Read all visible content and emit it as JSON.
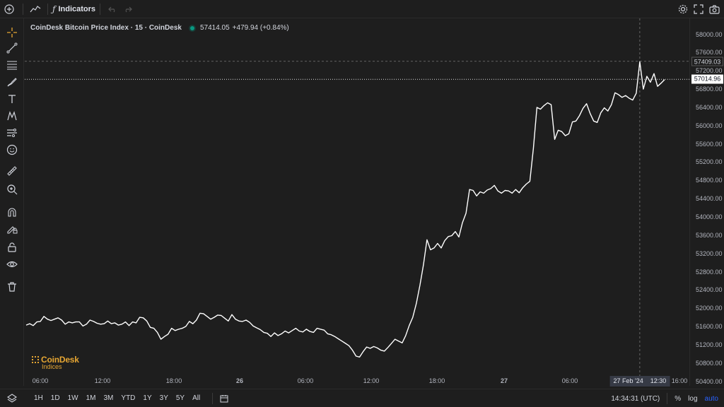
{
  "toolbar": {
    "indicators_label": "Indicators",
    "icons": [
      "add-icon",
      "line-chart-icon",
      "fx-icon",
      "undo-icon",
      "redo-icon",
      "settings-icon",
      "fullscreen-icon",
      "camera-icon"
    ]
  },
  "left_tools": [
    "crosshair-icon",
    "trend-line-icon",
    "fib-levels-icon",
    "brush-icon",
    "text-icon",
    "pattern-icon",
    "forecast-icon",
    "emoji-icon",
    "ruler-icon",
    "zoom-in-icon",
    "magnet-icon",
    "lock-drawing-icon",
    "lock-icon",
    "eye-icon",
    "trash-icon"
  ],
  "legend": {
    "symbol": "CoinDesk Bitcoin Price Index · 15 · CoinDesk",
    "price": "57414.05",
    "change": "+479.94 (+0.84%)"
  },
  "logo": {
    "name": "CoinDesk",
    "sub": "Indices"
  },
  "price_axis": {
    "ticks": [
      "58000.00",
      "57600.00",
      "57200.00",
      "56800.00",
      "56400.00",
      "56000.00",
      "55600.00",
      "55200.00",
      "54800.00",
      "54400.00",
      "54000.00",
      "53600.00",
      "53200.00",
      "52800.00",
      "52400.00",
      "52000.00",
      "51600.00",
      "51200.00",
      "50800.00",
      "50400.00"
    ],
    "crosshair_label": "57409.03",
    "last_price_label": "57014.96"
  },
  "time_axis": {
    "ticks": [
      "06:00",
      "12:00",
      "18:00",
      "26",
      "06:00",
      "12:00",
      "18:00",
      "27",
      "06:00",
      "16:00"
    ],
    "crosshair_date": "27 Feb '24",
    "crosshair_time": "12:30"
  },
  "bottom": {
    "ranges": [
      "1H",
      "1D",
      "1W",
      "1M",
      "3M",
      "YTD",
      "1Y",
      "3Y",
      "5Y",
      "All"
    ],
    "clock": "14:34:31 (UTC)",
    "percent": "%",
    "log": "log",
    "auto": "auto"
  },
  "chart_data": {
    "type": "line",
    "title": "CoinDesk Bitcoin Price Index · 15 · CoinDesk",
    "xlabel": "",
    "ylabel": "",
    "ylim": [
      50300,
      58350
    ],
    "x_ticks": [
      "06:00",
      "12:00",
      "18:00",
      "26",
      "06:00",
      "12:00",
      "18:00",
      "27",
      "06:00",
      "16:00"
    ],
    "series": [
      {
        "values": [
          51630,
          51660,
          51620,
          51700,
          51710,
          51820,
          51760,
          51730,
          51760,
          51790,
          51740,
          51650,
          51700,
          51680,
          51700,
          51700,
          51610,
          51650,
          51740,
          51710,
          51670,
          51650,
          51660,
          51720,
          51660,
          51680,
          51630,
          51650,
          51700,
          51620,
          51700,
          51680,
          51800,
          51790,
          51720,
          51580,
          51560,
          51470,
          51320,
          51380,
          51430,
          51560,
          51510,
          51540,
          51560,
          51600,
          51710,
          51660,
          51740,
          51890,
          51880,
          51820,
          51760,
          51800,
          51850,
          51840,
          51780,
          51720,
          51860,
          51760,
          51720,
          51710,
          51740,
          51690,
          51610,
          51570,
          51530,
          51470,
          51450,
          51380,
          51460,
          51400,
          51440,
          51500,
          51460,
          51510,
          51560,
          51500,
          51480,
          51540,
          51490,
          51470,
          51560,
          51540,
          51520,
          51440,
          51420,
          51380,
          51330,
          51280,
          51230,
          51180,
          51080,
          50950,
          50930,
          51050,
          51150,
          51120,
          51160,
          51130,
          51080,
          51060,
          51140,
          51230,
          51320,
          51280,
          51240,
          51400,
          51620,
          51800,
          52100,
          52500,
          52950,
          53500,
          53280,
          53320,
          53420,
          53320,
          53480,
          53570,
          53590,
          53680,
          53560,
          53870,
          54080,
          54600,
          54580,
          54460,
          54550,
          54520,
          54590,
          54620,
          54690,
          54570,
          54520,
          54580,
          54570,
          54520,
          54600,
          54530,
          54640,
          54720,
          54780,
          55500,
          56400,
          56360,
          56440,
          56500,
          56460,
          55700,
          55900,
          55870,
          55780,
          55820,
          56080,
          56100,
          56220,
          56380,
          56480,
          56270,
          56100,
          56070,
          56280,
          56390,
          56320,
          56460,
          56720,
          56680,
          56620,
          56660,
          56600,
          56560,
          56710,
          57400,
          56800,
          57080,
          56950,
          57140,
          56860,
          56930,
          57010
        ]
      }
    ],
    "grid": false,
    "crosshair_price": 57409.03,
    "last_price": 57014.96
  }
}
